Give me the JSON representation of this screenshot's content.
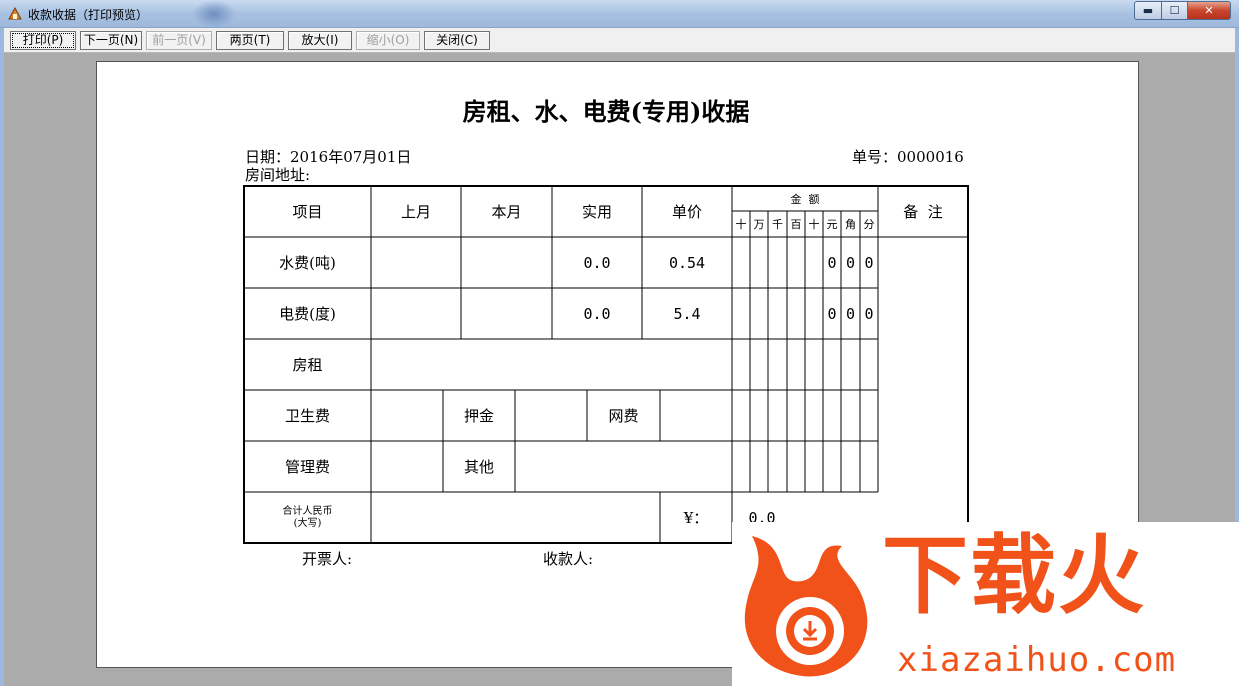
{
  "window": {
    "title": "收款收据（打印预览）",
    "min_label": "▬",
    "max_label": "☐",
    "close_label": "✕"
  },
  "toolbar": {
    "print": "打印(P)",
    "next_page": "下一页(N)",
    "prev_page": "前一页(V)",
    "two_pages": "两页(T)",
    "zoom_in": "放大(I)",
    "zoom_out": "缩小(O)",
    "close": "关闭(C)"
  },
  "receipt": {
    "title": "房租、水、电费(专用)收据",
    "date_label": "日期：",
    "date": "2016年07月01日",
    "number_label": "单号：",
    "number": "0000016",
    "address_label": "房间地址:",
    "headers": {
      "item": "项目",
      "last_month": "上月",
      "this_month": "本月",
      "actual": "实用",
      "unit_price": "单价",
      "amount": "金  额",
      "remarks": "备  注",
      "digits": [
        "十",
        "万",
        "千",
        "百",
        "十",
        "元",
        "角",
        "分"
      ]
    },
    "rows": {
      "water": {
        "label": "水费(吨)",
        "actual": "0.0",
        "price": "0.54",
        "digits": [
          "0",
          "0",
          "0"
        ]
      },
      "power": {
        "label": "电费(度)",
        "actual": "0.0",
        "price": "5.4",
        "digits": [
          "0",
          "0",
          "0"
        ]
      },
      "rent": {
        "label": "房租"
      },
      "sanitation": {
        "label": "卫生费",
        "deposit": "押金",
        "network": "网费"
      },
      "management": {
        "label": "管理费",
        "other": "其他"
      },
      "total": {
        "label_line1": "合计人民币",
        "label_line2": "(大写)",
        "yen": "¥：",
        "value": "0.0"
      }
    },
    "drawer_label": "开票人:",
    "payee_label": "收款人:"
  },
  "watermark": {
    "brand": "下载火",
    "url": "xiazaihuo.com",
    "color": "#f0521a"
  }
}
